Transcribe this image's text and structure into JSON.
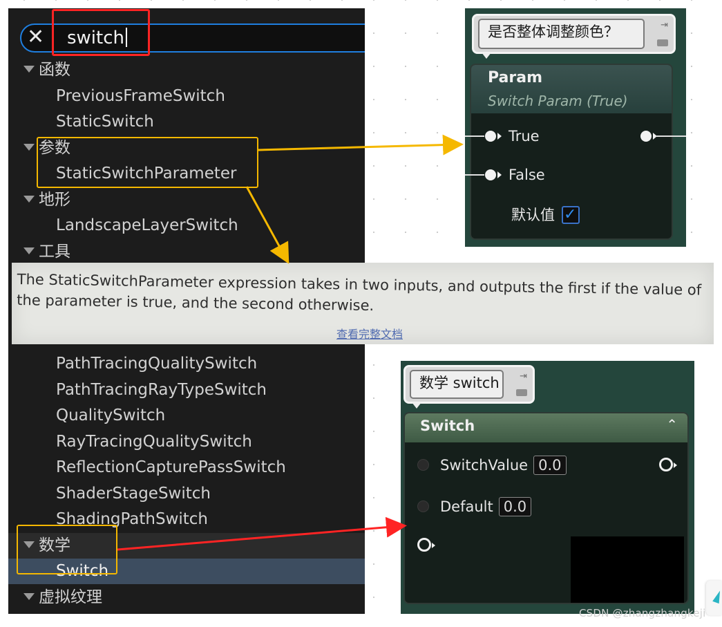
{
  "search": {
    "query": "switch",
    "clear_icon": "close-icon"
  },
  "list": [
    {
      "kind": "cat",
      "label": "函数"
    },
    {
      "kind": "item",
      "label": "PreviousFrameSwitch"
    },
    {
      "kind": "item",
      "label": "StaticSwitch"
    },
    {
      "kind": "cat",
      "label": "参数"
    },
    {
      "kind": "item",
      "label": "StaticSwitchParameter"
    },
    {
      "kind": "cat",
      "label": "地形"
    },
    {
      "kind": "item",
      "label": "LandscapeLayerSwitch"
    },
    {
      "kind": "cat",
      "label": "工具"
    },
    {
      "kind": "item",
      "label": "PathTracingQualitySwitch"
    },
    {
      "kind": "item",
      "label": "PathTracingRayTypeSwitch"
    },
    {
      "kind": "item",
      "label": "QualitySwitch"
    },
    {
      "kind": "item",
      "label": "RayTracingQualitySwitch"
    },
    {
      "kind": "item",
      "label": "ReflectionCapturePassSwitch"
    },
    {
      "kind": "item",
      "label": "ShaderStageSwitch"
    },
    {
      "kind": "item",
      "label": "ShadingPathSwitch"
    },
    {
      "kind": "cat",
      "label": "数学"
    },
    {
      "kind": "item",
      "label": "Switch",
      "selected": true
    },
    {
      "kind": "cat",
      "label": "虚拟纹理"
    }
  ],
  "tooltip": {
    "text": "The StaticSwitchParameter expression takes in two inputs, and outputs the first if the value of the parameter is true, and the second otherwise.",
    "link": "查看完整文档"
  },
  "node_param": {
    "comment": "是否整体调整颜色？",
    "title": "Param",
    "subtitle": "Switch Param (True)",
    "pin_true": "True",
    "pin_false": "False",
    "default_label": "默认值",
    "default_checked": true
  },
  "node_switch": {
    "comment": "数学 switch",
    "title": "Switch",
    "pin_switch_value": "SwitchValue",
    "switch_value": "0.0",
    "pin_default": "Default",
    "default_value": "0.0"
  },
  "colors": {
    "highlight_red": "#ff2424",
    "highlight_yellow": "#f5b800",
    "accent_blue": "#1f7fe0"
  },
  "watermark": "CSDN @zhangzhangkeji"
}
